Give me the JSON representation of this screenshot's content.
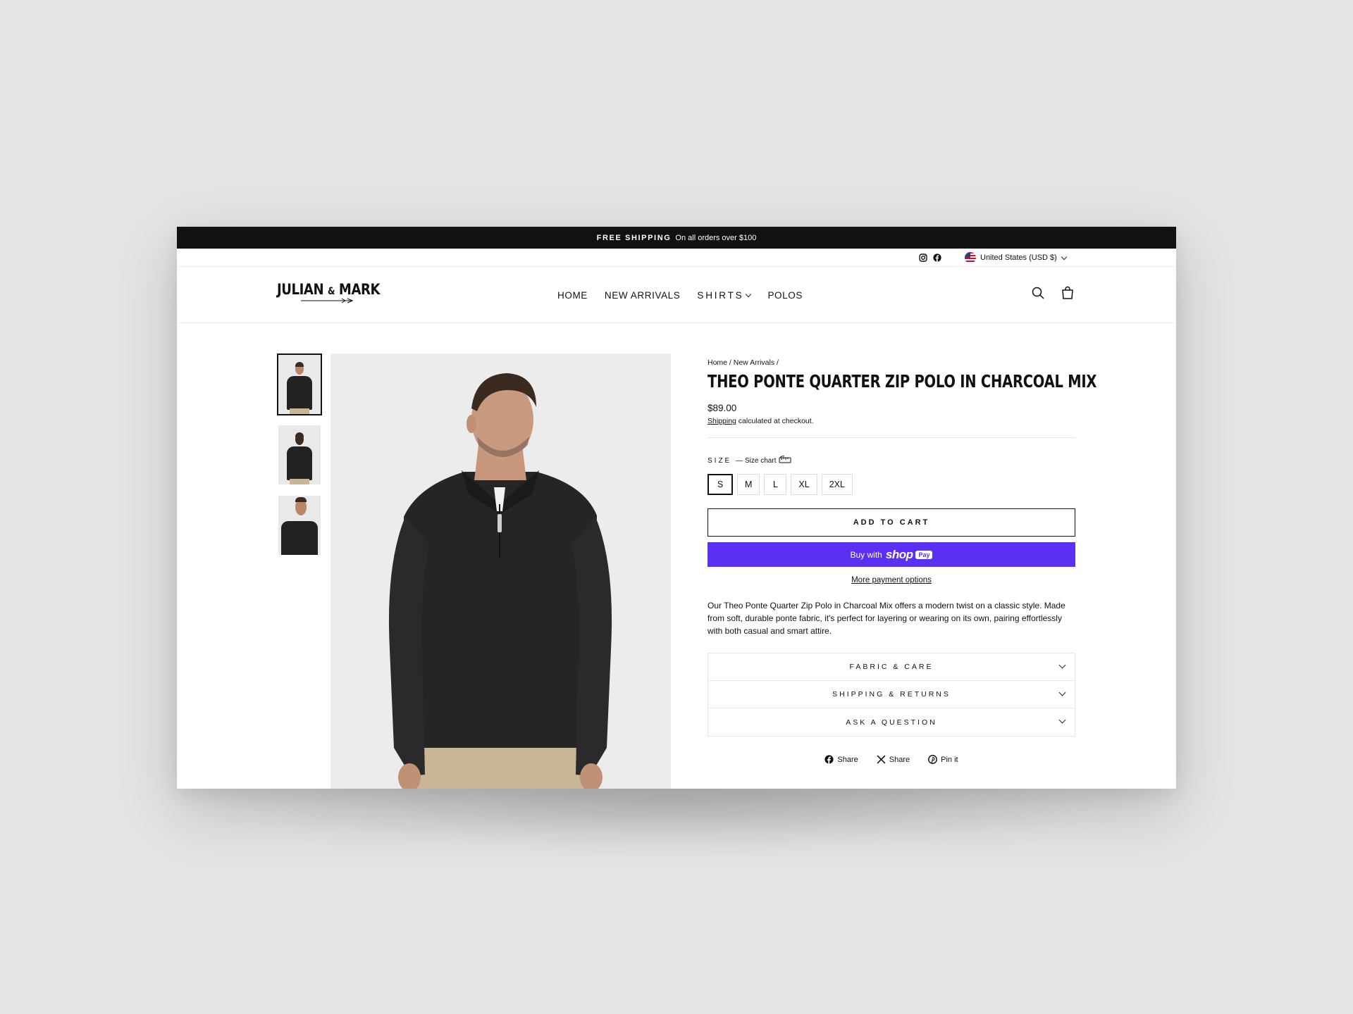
{
  "announcement": {
    "strong": "FREE SHIPPING",
    "text": "On all orders over $100"
  },
  "utility": {
    "social": [
      "instagram-icon",
      "facebook-icon"
    ],
    "country": "United States (USD $)"
  },
  "header": {
    "logo_left": "JULIAN",
    "logo_amp": "&",
    "logo_right": "MARK",
    "nav": {
      "home": "HOME",
      "new_arrivals": "NEW ARRIVALS",
      "shirts": "SHIRTS",
      "polos": "POLOS"
    },
    "icons": [
      "search-icon",
      "cart-icon"
    ]
  },
  "product": {
    "breadcrumb": "Home / New Arrivals /",
    "title": "Theo Ponte Quarter Zip Polo in Charcoal Mix",
    "price": "$89.00",
    "shipping_link": "Shipping",
    "shipping_note": " calculated at checkout.",
    "size_label": "SIZE",
    "size_chart": "— Size chart",
    "sizes": [
      "S",
      "M",
      "L",
      "XL",
      "2XL"
    ],
    "selected_size": "S",
    "add_to_cart": "ADD TO CART",
    "buy_with": "Buy with",
    "shop_word": "shop",
    "pay_word": "Pay",
    "more_payment": "More payment options",
    "description": "Our Theo Ponte Quarter Zip Polo in Charcoal Mix offers a modern twist on a classic style. Made from soft, durable ponte fabric, it's perfect for layering or wearing on its own, pairing effortlessly with both casual and smart attire.",
    "accordion": [
      "FABRIC & CARE",
      "SHIPPING & RETURNS",
      "ASK A QUESTION"
    ],
    "share": {
      "facebook": "Share",
      "x": "Share",
      "pinterest": "Pin it"
    }
  },
  "colors": {
    "announcement_bg": "#111111",
    "shop_pay": "#5a31f4",
    "page_bg": "#e4e4e4"
  }
}
